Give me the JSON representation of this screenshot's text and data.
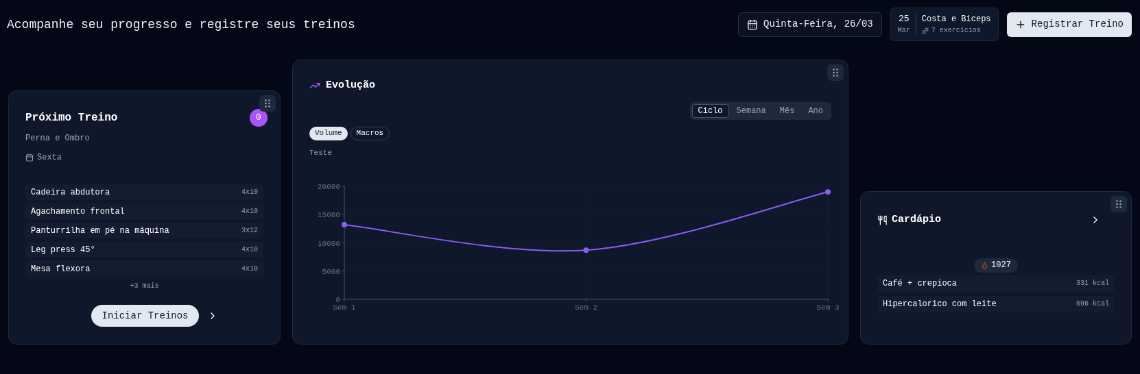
{
  "header": {
    "title": "Acompanhe seu progresso e registre seus treinos",
    "date_button": "Quinta-Feira, 26/03",
    "workout_chip": {
      "day": "25",
      "month": "Mar",
      "name": "Costa e Biceps",
      "exercises": "7 exercícios"
    },
    "register_button": "Registrar Treino"
  },
  "next_workout": {
    "title": "Próximo Treino",
    "badge": "0",
    "subtitle": "Perna e Ombro",
    "day": "Sexta",
    "exercises": [
      {
        "name": "Cadeira abdutora",
        "sets": "4x10"
      },
      {
        "name": "Agachamento frontal",
        "sets": "4x10"
      },
      {
        "name": "Panturrilha em pé na máquina",
        "sets": "3x12"
      },
      {
        "name": "Leg press 45°",
        "sets": "4x10"
      },
      {
        "name": "Mesa flexora",
        "sets": "4x10"
      }
    ],
    "more": "+3 mais",
    "start_button": "Iniciar Treinos"
  },
  "evolution": {
    "title": "Evolução",
    "periods": [
      {
        "label": "Ciclo",
        "selected": true
      },
      {
        "label": "Semana",
        "selected": false
      },
      {
        "label": "Mês",
        "selected": false
      },
      {
        "label": "Ano",
        "selected": false
      }
    ],
    "metrics": [
      {
        "label": "Volume",
        "selected": true
      },
      {
        "label": "Macros",
        "selected": false
      }
    ],
    "chart_label": "Teste",
    "chart_data": {
      "type": "line",
      "categories": [
        "Sem 1",
        "Sem 2",
        "Sem 3"
      ],
      "series": [
        {
          "color": "#8b5cf6",
          "marker": true,
          "values": [
            13200,
            8700,
            19000
          ]
        }
      ],
      "grid": true,
      "ylim": [
        0,
        20000
      ],
      "yticks": [
        0,
        5000,
        10000,
        15000,
        20000
      ]
    }
  },
  "menu": {
    "title": "Cardápio",
    "calories": "1027",
    "meals": [
      {
        "name": "Café + crepioca",
        "kcal": "331 kcal"
      },
      {
        "name": "Hipercalorico com leite",
        "kcal": "696 kcal"
      }
    ]
  }
}
